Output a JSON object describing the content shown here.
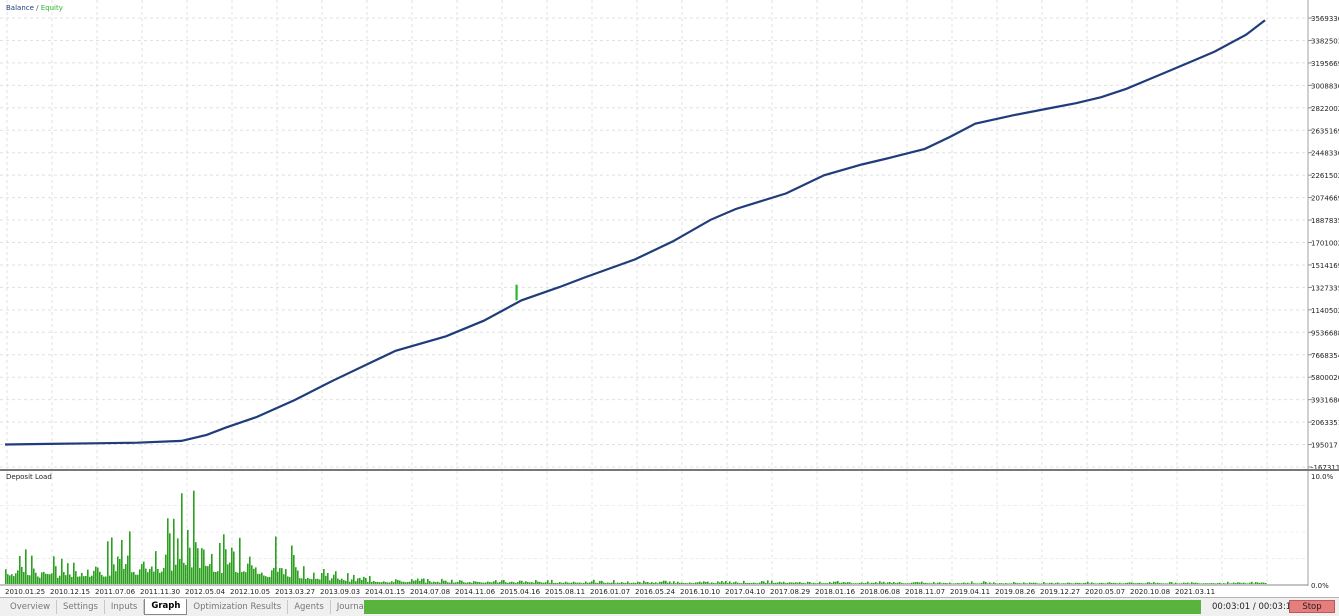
{
  "legend": {
    "balance": "Balance",
    "separator": "/",
    "equity": "Equity"
  },
  "colors": {
    "balance": "#1f3d7a",
    "equity": "#2db52d",
    "deposit_load": "#2aa01e",
    "grid": "#dcdcdc"
  },
  "deposit_panel": {
    "title": "Deposit Load",
    "max_label": "10.0%",
    "min_label": "0.0%"
  },
  "tabs": [
    {
      "label": "Overview"
    },
    {
      "label": "Settings"
    },
    {
      "label": "Inputs"
    },
    {
      "label": "Graph",
      "active": true
    },
    {
      "label": "Optimization Results"
    },
    {
      "label": "Agents"
    },
    {
      "label": "Journal"
    }
  ],
  "status": {
    "timer": "00:03:01 / 00:03:18",
    "stop_label": "Stop",
    "progress": 0.91
  },
  "chart_data": {
    "type": "line",
    "title": "",
    "y_tick_labels": [
      "35693364",
      "33825030",
      "31956696",
      "30088362",
      "28220028",
      "26351694",
      "24483360",
      "22615026",
      "20746692",
      "18878358",
      "17010024",
      "15141690",
      "13273356",
      "11405022",
      "9536688",
      "7668354",
      "5800020",
      "3931686",
      "2063351",
      "195017",
      "-1673117"
    ],
    "x_tick_labels": [
      "2010.01.25",
      "2010.12.15",
      "2011.07.06",
      "2011.11.30",
      "2012.05.04",
      "2012.10.05",
      "2013.03.27",
      "2013.09.03",
      "2014.01.15",
      "2014.07.08",
      "2014.11.06",
      "2015.04.16",
      "2015.08.11",
      "2016.01.07",
      "2016.05.24",
      "2016.10.10",
      "2017.04.10",
      "2017.08.29",
      "2018.01.16",
      "2018.06.08",
      "2018.11.07",
      "2019.04.11",
      "2019.08.26",
      "2019.12.27",
      "2020.05.07",
      "2020.10.08",
      "2021.03.11"
    ],
    "ylim": [
      -1673117,
      35693364
    ],
    "series": [
      {
        "name": "Balance",
        "x": [
          0,
          0.035,
          0.07,
          0.105,
          0.14,
          0.16,
          0.175,
          0.2,
          0.23,
          0.26,
          0.29,
          0.31,
          0.35,
          0.38,
          0.41,
          0.44,
          0.46,
          0.5,
          0.53,
          0.56,
          0.58,
          0.62,
          0.65,
          0.68,
          0.7,
          0.73,
          0.75,
          0.77,
          0.8,
          0.83,
          0.85,
          0.87,
          0.89,
          0.915,
          0.94,
          0.96,
          0.985,
          1.0
        ],
        "y": [
          200000,
          250000,
          300000,
          350000,
          500000,
          1000000,
          1600000,
          2500000,
          3900000,
          5500000,
          7000000,
          8000000,
          9200000,
          10500000,
          12200000,
          13300000,
          14100000,
          15600000,
          17100000,
          18900000,
          19800000,
          21100000,
          22600000,
          23500000,
          24000000,
          24800000,
          25800000,
          26900000,
          27600000,
          28200000,
          28600000,
          29100000,
          29800000,
          30900000,
          32000000,
          32900000,
          34300000,
          35500000
        ]
      },
      {
        "name": "Equity",
        "spike": {
          "x": 0.406,
          "y_low": 12200000,
          "y_high": 13500000
        }
      }
    ],
    "deposit_load": {
      "ylim": [
        0,
        10
      ],
      "envelope_x": [
        0,
        0.03,
        0.06,
        0.09,
        0.11,
        0.13,
        0.15,
        0.17,
        0.19,
        0.2,
        0.21,
        0.23,
        0.25,
        0.27,
        0.3,
        0.35,
        0.4,
        0.5,
        0.6,
        0.7,
        0.8,
        0.9,
        1.0
      ],
      "envelope_y": [
        2.6,
        2.0,
        2.8,
        2.6,
        3.6,
        4.6,
        6.2,
        4.2,
        4.0,
        2.8,
        2.6,
        2.2,
        1.6,
        0.9,
        0.6,
        0.5,
        0.4,
        0.3,
        0.3,
        0.25,
        0.2,
        0.2,
        0.2
      ]
    }
  }
}
